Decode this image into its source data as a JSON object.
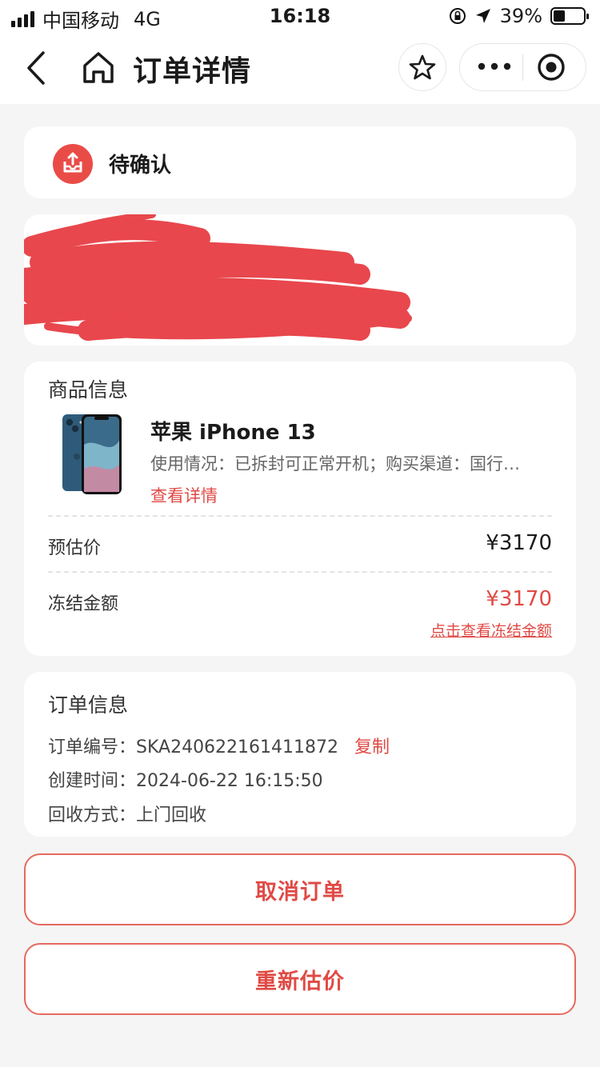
{
  "status_bar": {
    "carrier": "中国移动",
    "network": "4G",
    "time": "16:18",
    "battery": "39%",
    "battery_level": 0.39
  },
  "nav": {
    "title": "订单详情",
    "icons": [
      "back-arrow-icon",
      "home-icon",
      "star-icon",
      "more-icon",
      "target-icon"
    ]
  },
  "status": {
    "text": "待确认",
    "icon": "tray-upload-icon",
    "icon_color": "#e94c47"
  },
  "address": {
    "redacted": true,
    "redaction_color": "#e8474d"
  },
  "goods": {
    "section_title": "商品信息",
    "name": "苹果 iPhone 13",
    "desc": "使用情况：已拆封可正常开机；购买渠道：国行…",
    "detail_link": "查看详情",
    "est_label": "预估价",
    "est_value": "¥3170",
    "frozen_label": "冻结金额",
    "frozen_value": "¥3170",
    "frozen_link": "点击查看冻结金额"
  },
  "order": {
    "section_title": "订单信息",
    "number_label": "订单编号：",
    "number": "SKA240622161411872",
    "copy": "复制",
    "created_label": "创建时间：",
    "created": "2024-06-22 16:15:50",
    "method_label": "回收方式：",
    "method": "上门回收"
  },
  "buttons": {
    "cancel": "取消订单",
    "reprice": "重新估价"
  },
  "colors": {
    "accent": "#e04a45",
    "button_border": "#e56a5f",
    "background": "#f5f5f5"
  }
}
